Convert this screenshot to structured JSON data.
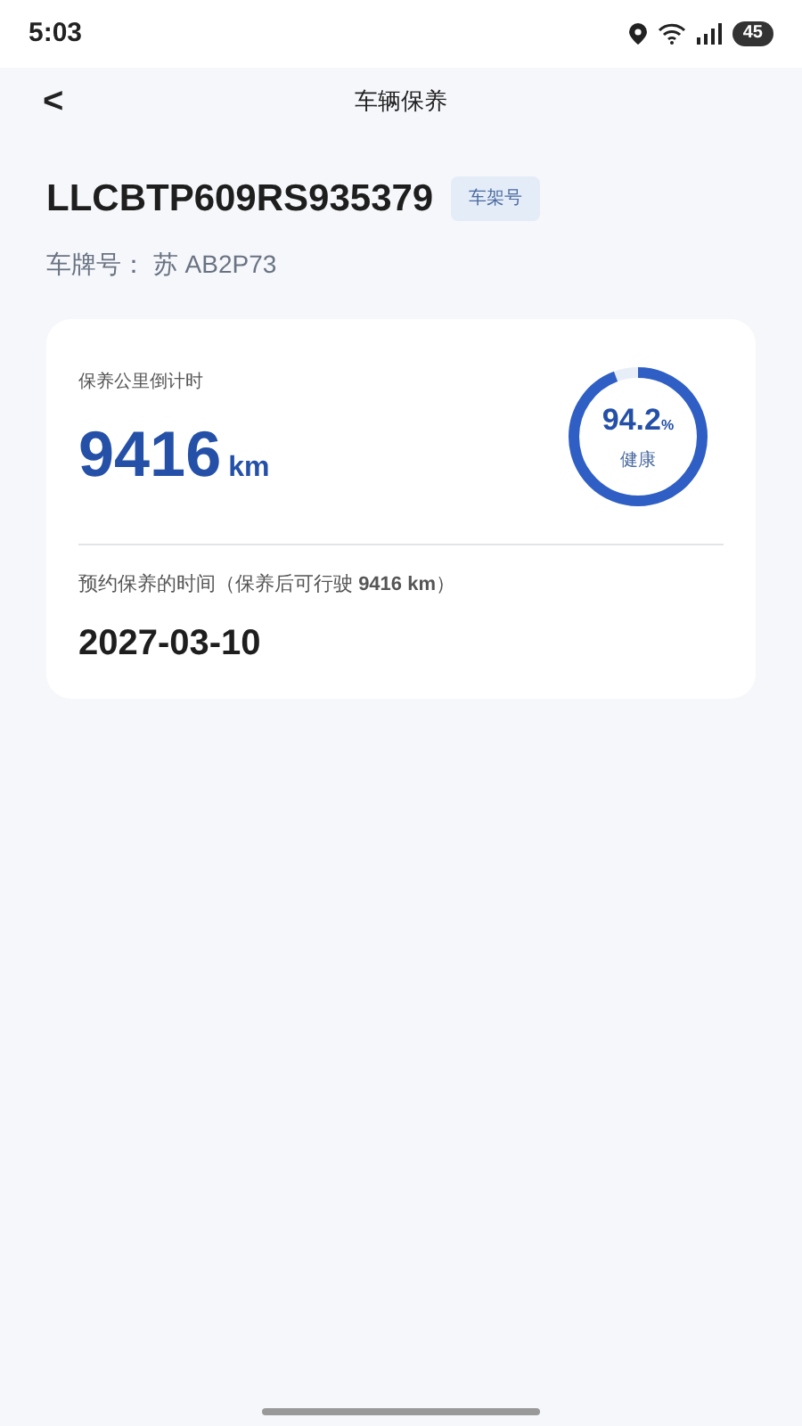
{
  "status_bar": {
    "time": "5:03",
    "battery": "45"
  },
  "nav": {
    "back": "<",
    "title": "车辆保养"
  },
  "vehicle": {
    "vin": "LLCBTP609RS935379",
    "vin_tag": "车架号",
    "plate": "车牌号： 苏 AB2P73"
  },
  "card": {
    "countdown_label": "保养公里倒计时",
    "countdown_value": "9416",
    "countdown_unit": "km",
    "health": {
      "value": "94.2",
      "unit": "%",
      "label": "健康",
      "level": 0.942
    },
    "schedule_label": "预约保养的时间（保养后可行驶 **9416 km**）",
    "schedule_date": "2027-03-10"
  }
}
